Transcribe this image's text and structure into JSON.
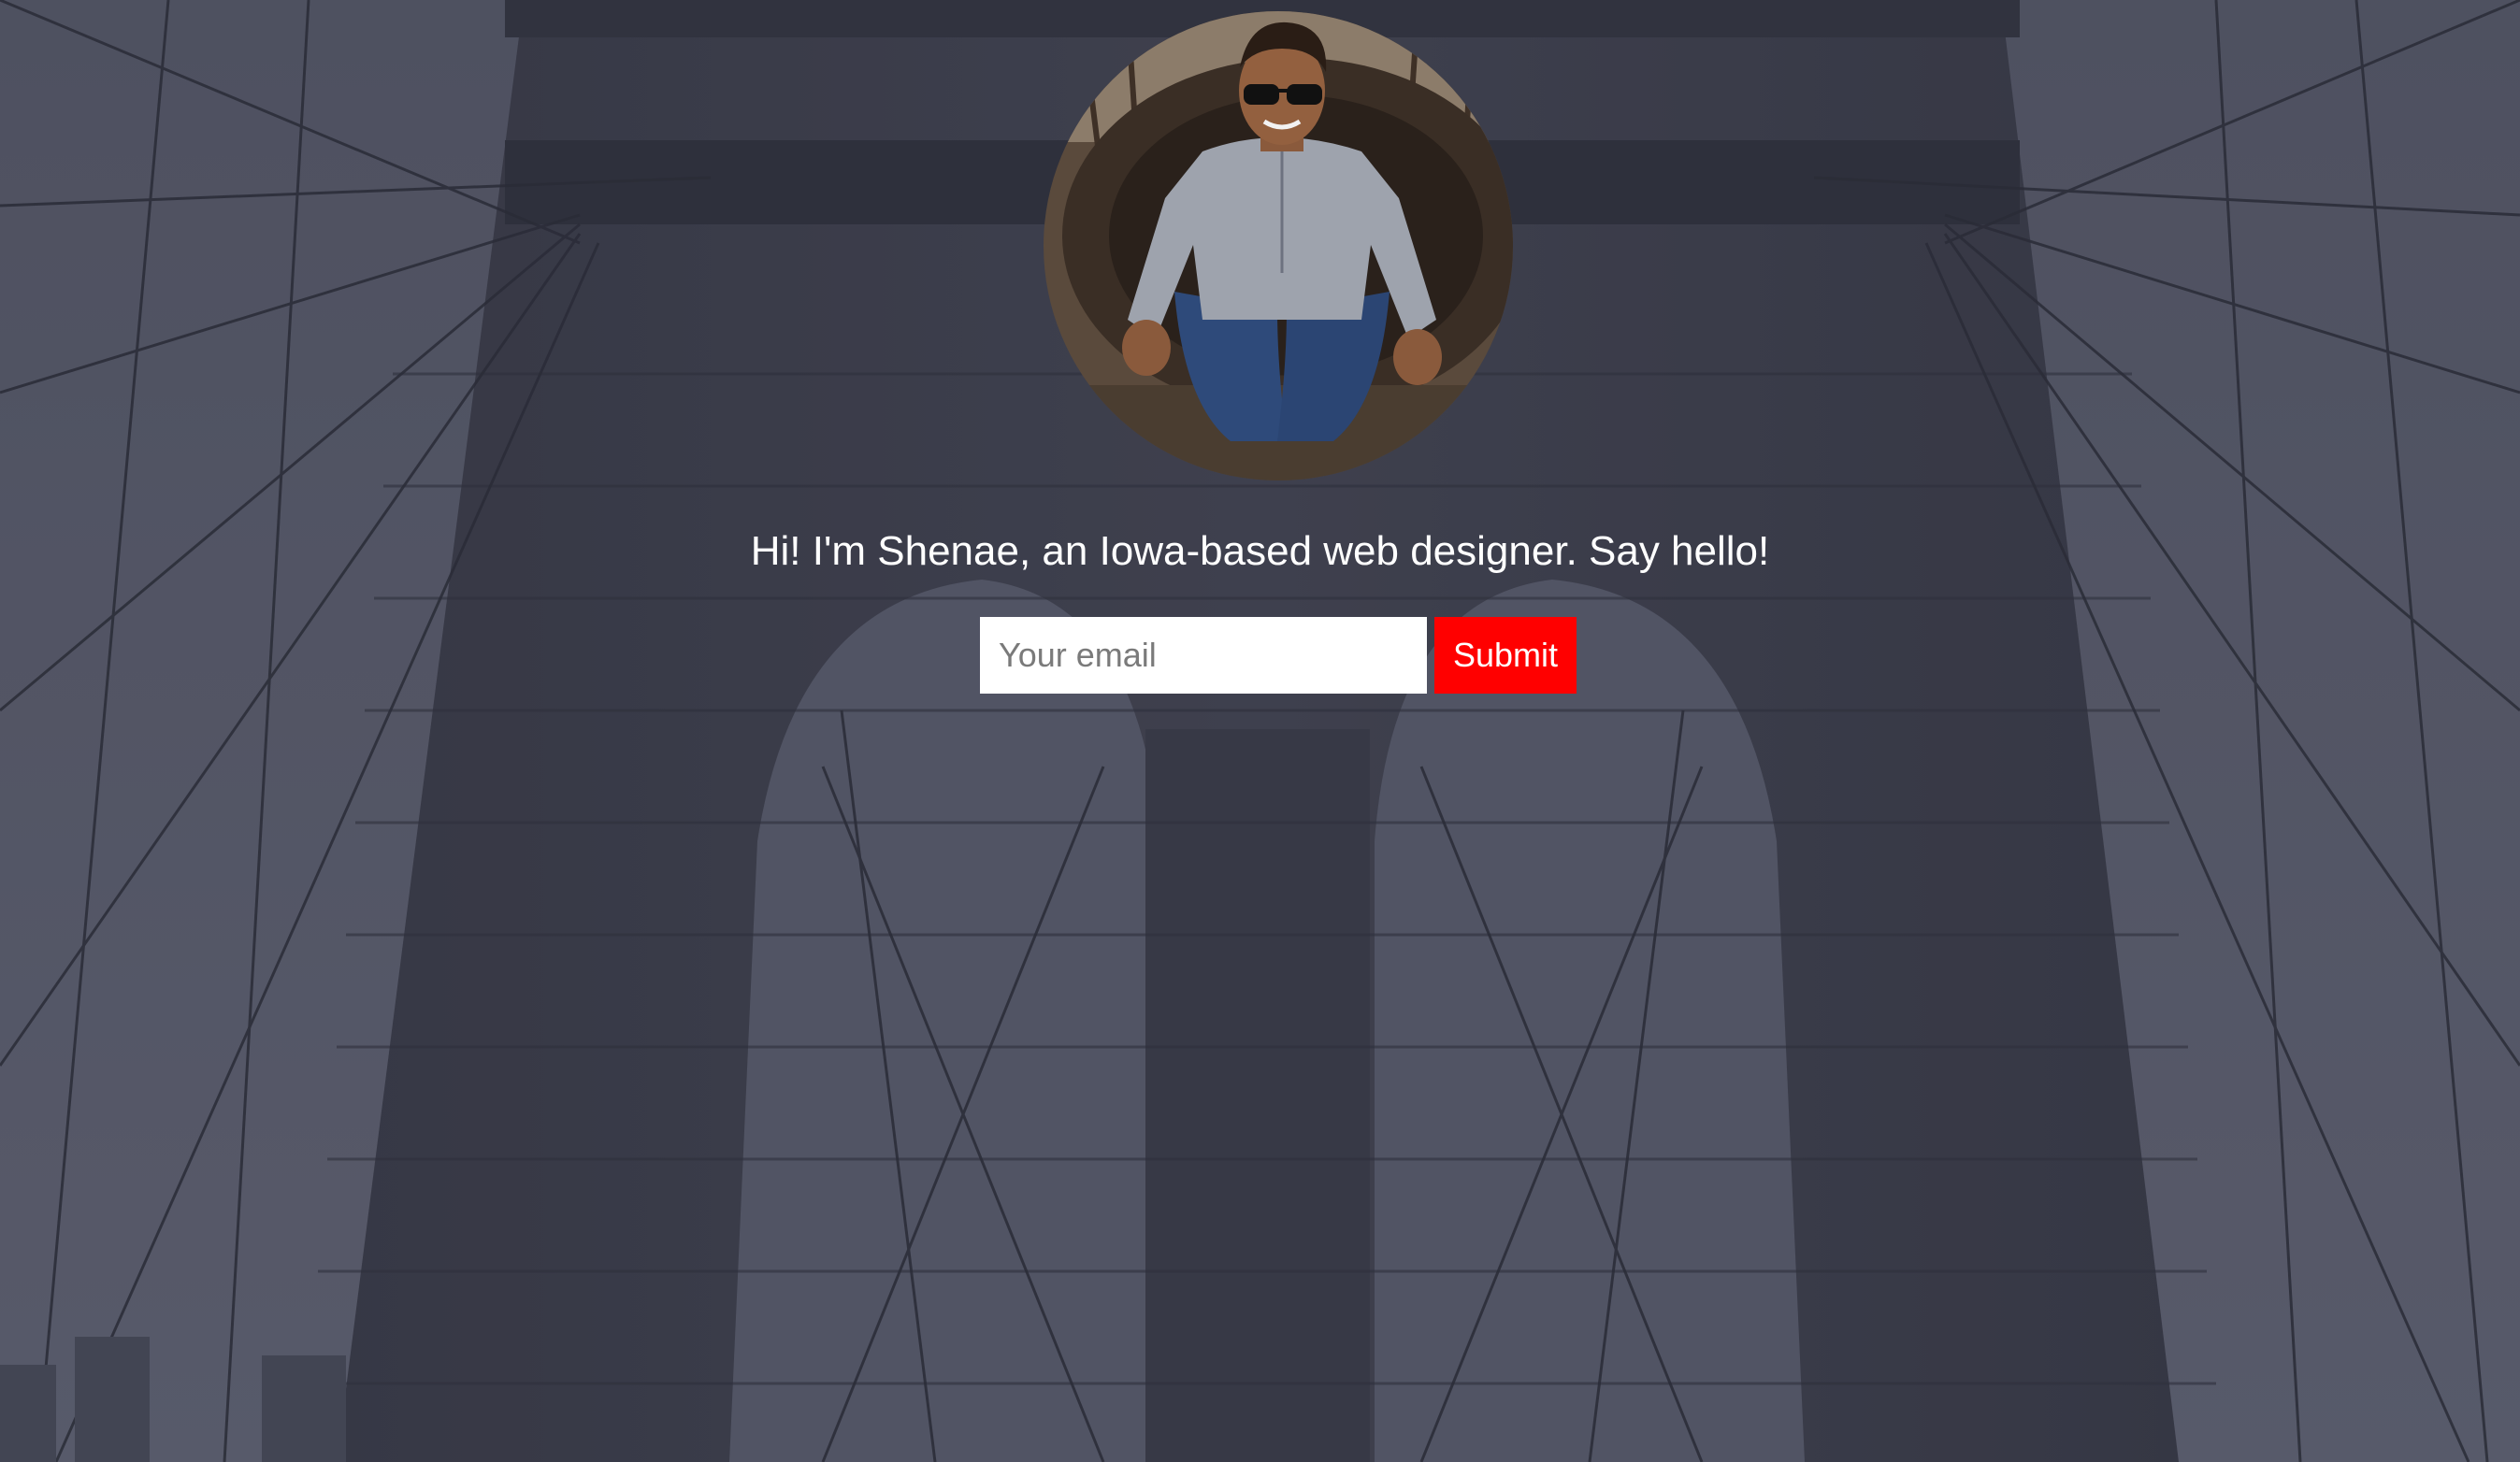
{
  "hero": {
    "tagline": "Hi! I'm Shenae, an Iowa-based web designer. Say hello!",
    "background_image": "brooklyn-bridge-photo",
    "avatar_image": "profile-photo"
  },
  "signup": {
    "email_placeholder": "Your email",
    "email_value": "",
    "submit_label": "Submit"
  },
  "colors": {
    "submit_bg": "#ff0000",
    "text": "#ffffff",
    "overlay": "#3f4152"
  }
}
